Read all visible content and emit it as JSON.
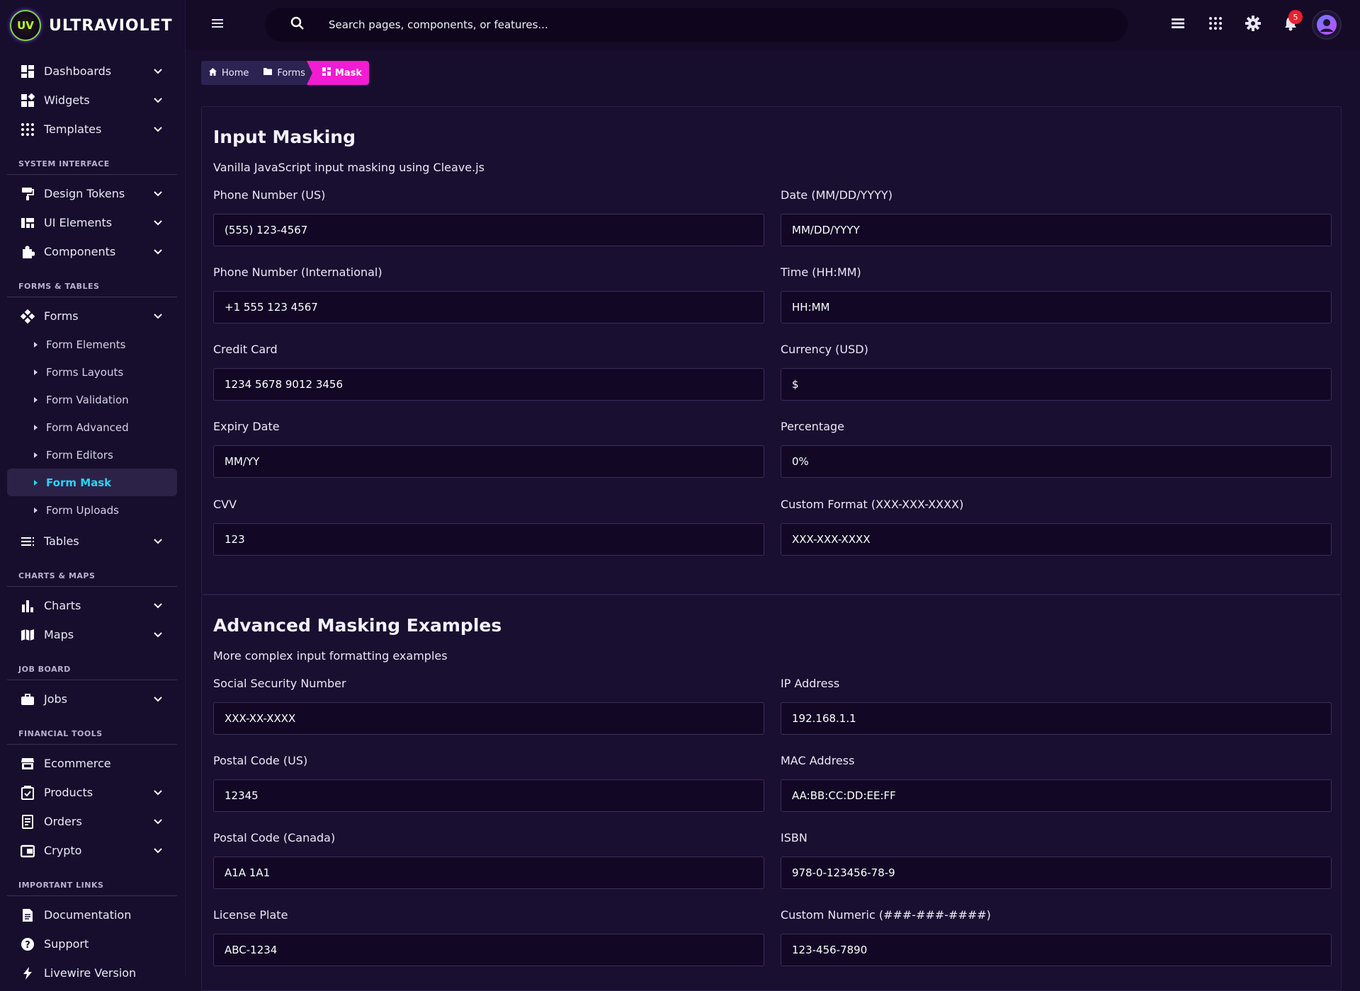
{
  "app": {
    "name": "ULTRAVIOLET",
    "logo_mark": "UV"
  },
  "search": {
    "placeholder": "Search pages, components, or features..."
  },
  "topbar": {
    "notification_count": "5",
    "icons": [
      "menu-icon",
      "search-icon",
      "list-icon",
      "apps-grid-icon",
      "gear-icon",
      "bell-icon",
      "avatar"
    ]
  },
  "sidebar": {
    "groups": [
      {
        "items": [
          {
            "label": "Dashboards",
            "icon": "dashboard-icon"
          },
          {
            "label": "Widgets",
            "icon": "widgets-icon"
          },
          {
            "label": "Templates",
            "icon": "grid-dots-icon"
          }
        ]
      },
      {
        "section": "SYSTEM INTERFACE",
        "items": [
          {
            "label": "Design Tokens",
            "icon": "paint-roller-icon"
          },
          {
            "label": "UI Elements",
            "icon": "ui-elements-icon"
          },
          {
            "label": "Components",
            "icon": "puzzle-icon"
          }
        ]
      },
      {
        "section": "FORMS & TABLES",
        "items": [
          {
            "label": "Forms",
            "icon": "forms-icon"
          },
          {
            "label": "Tables",
            "icon": "table-icon"
          }
        ],
        "subitems": [
          "Form Elements",
          "Forms Layouts",
          "Form Validation",
          "Form Advanced",
          "Form Editors",
          "Form Mask",
          "Form Uploads"
        ],
        "active_subitem": "Form Mask"
      },
      {
        "section": "CHARTS & MAPS",
        "items": [
          {
            "label": "Charts",
            "icon": "bar-chart-icon"
          },
          {
            "label": "Maps",
            "icon": "map-icon"
          }
        ]
      },
      {
        "section": "JOB BOARD",
        "items": [
          {
            "label": "Jobs",
            "icon": "briefcase-icon"
          }
        ]
      },
      {
        "section": "FINANCIAL TOOLS",
        "items": [
          {
            "label": "Ecommerce",
            "icon": "store-icon"
          },
          {
            "label": "Products",
            "icon": "products-icon"
          },
          {
            "label": "Orders",
            "icon": "receipt-icon"
          },
          {
            "label": "Crypto",
            "icon": "wallet-icon"
          }
        ]
      },
      {
        "section": "IMPORTANT LINKS",
        "items": [
          {
            "label": "Documentation",
            "icon": "document-icon"
          },
          {
            "label": "Support",
            "icon": "help-icon"
          },
          {
            "label": "Livewire Version",
            "icon": "bolt-icon"
          }
        ]
      }
    ]
  },
  "breadcrumb": [
    {
      "label": "Home",
      "icon": "home-icon"
    },
    {
      "label": "Forms",
      "icon": "folder-icon"
    },
    {
      "label": "Mask",
      "icon": "dashboard-icon"
    }
  ],
  "input_masking": {
    "title": "Input Masking",
    "description": "Vanilla JavaScript input masking using Cleave.js",
    "fields": [
      {
        "label": "Phone Number (US)",
        "placeholder": "(555) 123-4567"
      },
      {
        "label": "Date (MM/DD/YYYY)",
        "placeholder": "MM/DD/YYYY"
      },
      {
        "label": "Phone Number (International)",
        "placeholder": "+1 555 123 4567"
      },
      {
        "label": "Time (HH:MM)",
        "placeholder": "HH:MM"
      },
      {
        "label": "Credit Card",
        "placeholder": "1234 5678 9012 3456"
      },
      {
        "label": "Currency (USD)",
        "placeholder": "$"
      },
      {
        "label": "Expiry Date",
        "placeholder": "MM/YY"
      },
      {
        "label": "Percentage",
        "placeholder": "0%"
      },
      {
        "label": "CVV",
        "placeholder": "123"
      },
      {
        "label": "Custom Format (XXX-XXX-XXXX)",
        "placeholder": "XXX-XXX-XXXX"
      }
    ]
  },
  "advanced_masking": {
    "title": "Advanced Masking Examples",
    "description": "More complex input formatting examples",
    "fields": [
      {
        "label": "Social Security Number",
        "placeholder": "XXX-XX-XXXX"
      },
      {
        "label": "IP Address",
        "placeholder": "192.168.1.1"
      },
      {
        "label": "Postal Code (US)",
        "placeholder": "12345"
      },
      {
        "label": "MAC Address",
        "placeholder": "AA:BB:CC:DD:EE:FF"
      },
      {
        "label": "Postal Code (Canada)",
        "placeholder": "A1A 1A1"
      },
      {
        "label": "ISBN",
        "placeholder": "978-0-123456-78-9"
      },
      {
        "label": "License Plate",
        "placeholder": "ABC-1234"
      },
      {
        "label": "Custom Numeric (###-###-####)",
        "placeholder": "123-456-7890"
      }
    ]
  }
}
